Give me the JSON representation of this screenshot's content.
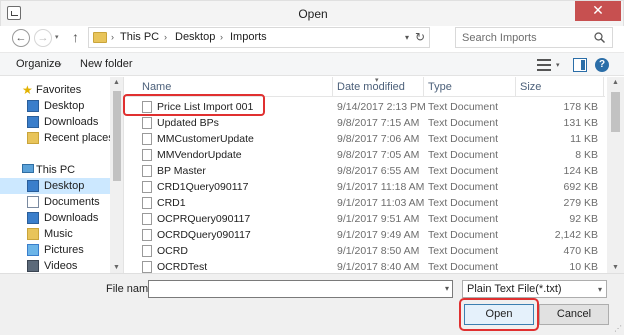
{
  "window": {
    "title": "Open",
    "close_glyph": "✕"
  },
  "nav": {
    "back_glyph": "←",
    "forward_glyph": "→",
    "recent_glyph": "▾",
    "up_glyph": "↑",
    "breadcrumbs": [
      "This PC",
      "Desktop",
      "Imports"
    ],
    "separator": "›",
    "search_placeholder": "Search Imports"
  },
  "toolbar": {
    "organize": "Organize",
    "new_folder": "New folder",
    "caret": "▾"
  },
  "sidebar": {
    "groups": [
      {
        "label": "Favorites",
        "icon": "star-icon",
        "items": [
          {
            "label": "Desktop",
            "icon": "desktop-icon"
          },
          {
            "label": "Downloads",
            "icon": "downloads-icon"
          },
          {
            "label": "Recent places",
            "icon": "recent-places-icon"
          }
        ]
      },
      {
        "label": "This PC",
        "icon": "computer-icon",
        "items": [
          {
            "label": "Desktop",
            "icon": "desktop-icon",
            "selected": true
          },
          {
            "label": "Documents",
            "icon": "documents-icon"
          },
          {
            "label": "Downloads",
            "icon": "downloads-icon"
          },
          {
            "label": "Music",
            "icon": "music-icon"
          },
          {
            "label": "Pictures",
            "icon": "pictures-icon"
          },
          {
            "label": "Videos",
            "icon": "videos-icon"
          }
        ]
      }
    ]
  },
  "file_list": {
    "columns": {
      "name": "Name",
      "date": "Date modified",
      "type": "Type",
      "size": "Size"
    },
    "rows": [
      {
        "name": "Price List Import 001",
        "date": "9/14/2017 2:13 PM",
        "type": "Text Document",
        "size": "178 KB",
        "highlighted": true
      },
      {
        "name": "Updated BPs",
        "date": "9/8/2017 7:15 AM",
        "type": "Text Document",
        "size": "131 KB"
      },
      {
        "name": "MMCustomerUpdate",
        "date": "9/8/2017 7:06 AM",
        "type": "Text Document",
        "size": "11 KB"
      },
      {
        "name": "MMVendorUpdate",
        "date": "9/8/2017 7:05 AM",
        "type": "Text Document",
        "size": "8 KB"
      },
      {
        "name": "BP Master",
        "date": "9/8/2017 6:55 AM",
        "type": "Text Document",
        "size": "124 KB"
      },
      {
        "name": "CRD1Query090117",
        "date": "9/1/2017 11:18 AM",
        "type": "Text Document",
        "size": "692 KB"
      },
      {
        "name": "CRD1",
        "date": "9/1/2017 11:03 AM",
        "type": "Text Document",
        "size": "279 KB"
      },
      {
        "name": "OCPRQuery090117",
        "date": "9/1/2017 9:51 AM",
        "type": "Text Document",
        "size": "92 KB"
      },
      {
        "name": "OCRDQuery090117",
        "date": "9/1/2017 9:49 AM",
        "type": "Text Document",
        "size": "2,142 KB"
      },
      {
        "name": "OCRD",
        "date": "9/1/2017 8:50 AM",
        "type": "Text Document",
        "size": "470 KB"
      },
      {
        "name": "OCRDTest",
        "date": "9/1/2017 8:40 AM",
        "type": "Text Document",
        "size": "10 KB"
      }
    ]
  },
  "bottom": {
    "file_name_label": "File name:",
    "file_name_value": "",
    "file_type": "Plain Text File(*.txt)",
    "open_button": "Open",
    "cancel_button": "Cancel"
  },
  "colors": {
    "highlight": "#e03030",
    "selection": "#cce8ff",
    "close": "#c75050"
  }
}
